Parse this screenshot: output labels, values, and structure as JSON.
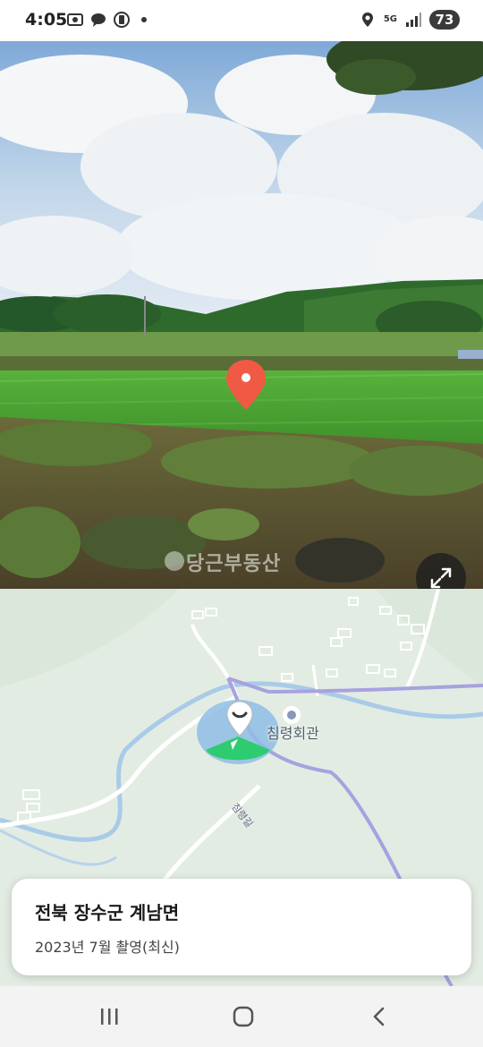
{
  "status_bar": {
    "time": "4:05",
    "network": "5G",
    "battery": "73",
    "icons": [
      "screenshot-icon",
      "chat-icon",
      "battery-saver-icon",
      "location-icon",
      "signal-icon"
    ]
  },
  "street_view": {
    "watermark": "당근부동산",
    "expand_icon": "expand-arrows-icon",
    "pin_icon": "map-pin-icon"
  },
  "map": {
    "poi_label": "침령회관",
    "road_label": "침령길"
  },
  "info_card": {
    "title": "전북 장수군 계남면",
    "subtitle": "2023년 7월 촬영(최신)"
  },
  "nav_bar": {
    "icons": [
      "recent-apps-icon",
      "home-icon",
      "back-icon"
    ]
  },
  "colors": {
    "pin": "#f05a44",
    "view_cone": "#2ecc71",
    "route": "#a7a2e0",
    "water": "#a9cbe8"
  }
}
